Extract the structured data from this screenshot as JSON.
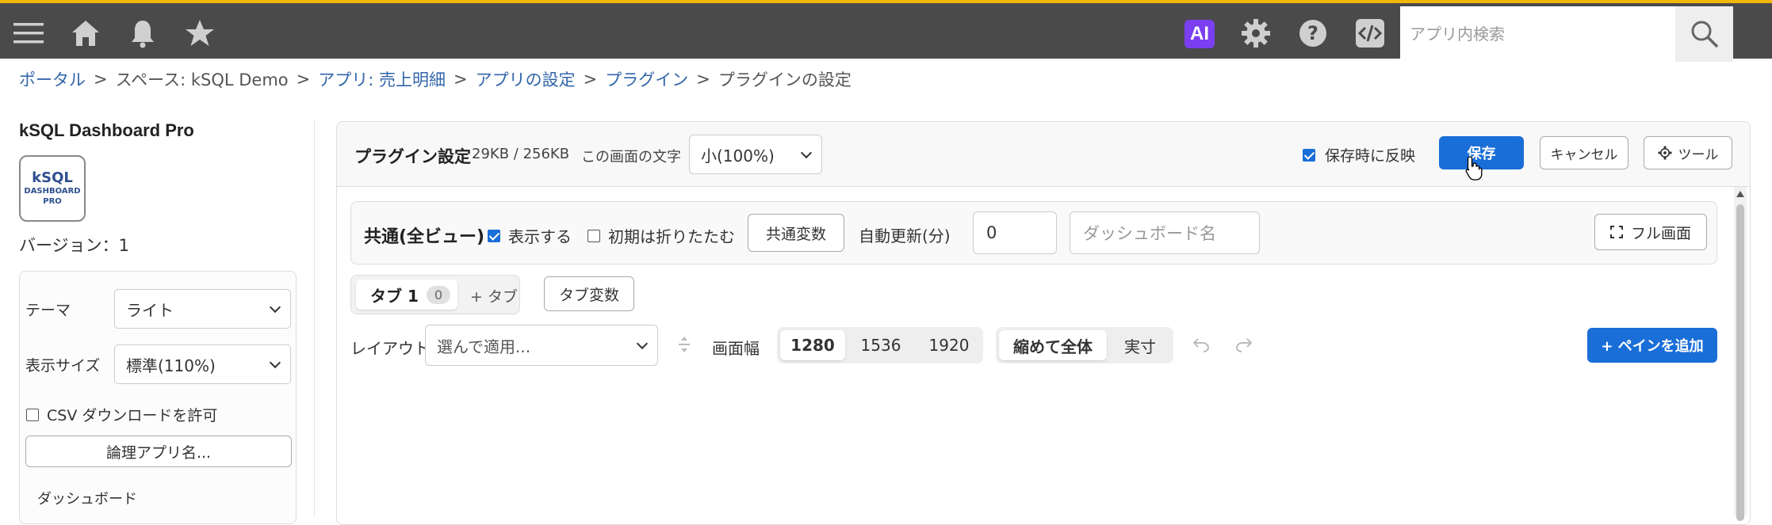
{
  "topbar": {
    "ai_label": "AI",
    "search_placeholder": "アプリ内検索"
  },
  "breadcrumb": [
    {
      "label": "ポータル"
    },
    {
      "label": "スペース: kSQL Demo"
    },
    {
      "label": "アプリ: 売上明細"
    },
    {
      "label": "アプリの設定"
    },
    {
      "label": "プラグイン"
    },
    {
      "label": "プラグインの設定"
    }
  ],
  "breadcrumb_sep": ">",
  "sidebar": {
    "title": "kSQL Dashboard Pro",
    "logo_line1": "kSQL",
    "logo_line2": "DASHBOARD",
    "logo_line3": "PRO",
    "version": "バージョン：1",
    "theme_label": "テーマ",
    "theme_value": "ライト",
    "size_label": "表示サイズ",
    "size_value": "標準(110%)",
    "csv_label": "CSV ダウンロードを許可",
    "logical_app_button": "論理アプリ名...",
    "dashboard_label": "ダッシュボード"
  },
  "header": {
    "title": "プラグイン設定",
    "size_info": "29KB / 256KB",
    "font_label": "この画面の文字",
    "font_value": "小(100%)",
    "reflect_label": "保存時に反映",
    "save": "保存",
    "cancel": "キャンセル",
    "tools": "ツール"
  },
  "common": {
    "title": "共通(全ビュー)",
    "show_label": "表示する",
    "collapse_label": "初期は折りたたむ",
    "common_vars": "共通変数",
    "auto_refresh_label": "自動更新(分)",
    "auto_refresh_value": "0",
    "dashboard_name_placeholder": "ダッシュボード名",
    "fullscreen": "フル画面"
  },
  "tabs": {
    "tab1_label": "タブ 1",
    "tab1_count": "0",
    "add_tab": "+ タブ",
    "tab_vars": "タブ変数"
  },
  "layout": {
    "label": "レイアウト",
    "select_placeholder": "選んで適用...",
    "width_label": "画面幅",
    "widths": [
      "1280",
      "1536",
      "1920"
    ],
    "fit_label": "縮めて全体",
    "actual_label": "実寸",
    "add_pane": "+ ペインを追加"
  },
  "colors": {
    "topbar_bg": "#4a4a4a",
    "accent_border": "#f2b705",
    "primary": "#1a6ed8",
    "ai_badge": "#7b3ff2",
    "link": "#3366aa"
  }
}
